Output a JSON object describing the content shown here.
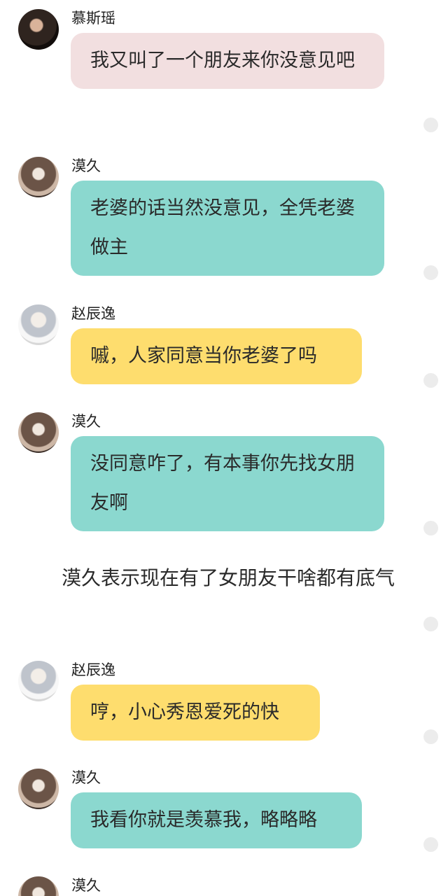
{
  "colors": {
    "pink_bubble": "#f2dfe0",
    "teal_bubble": "#8bd8cf",
    "yellow_bubble": "#fedd6e",
    "dot": "#ececec"
  },
  "messages": [
    {
      "name": "慕斯瑶",
      "text": "我又叫了一个朋友来你没意见吧",
      "color": "pink",
      "avatar": "a-dark"
    },
    {
      "name": "漠久",
      "text": "老婆的话当然没意见，全凭老婆做主",
      "color": "teal",
      "avatar": "a-hat"
    },
    {
      "name": "赵辰逸",
      "text": "嘁，人家同意当你老婆了吗",
      "color": "yellow",
      "avatar": "a-white"
    },
    {
      "name": "漠久",
      "text": "没同意咋了，有本事你先找女朋友啊",
      "color": "teal",
      "avatar": "a-hat"
    },
    {
      "name": "赵辰逸",
      "text": "哼，小心秀恩爱死的快",
      "color": "yellow",
      "avatar": "a-white"
    },
    {
      "name": "漠久",
      "text": "我看你就是羡慕我，略略略",
      "color": "teal",
      "avatar": "a-hat"
    },
    {
      "name": "漠久",
      "text": "",
      "color": "teal",
      "avatar": "a-hat"
    }
  ],
  "narration": "漠久表示现在有了女朋友干啥都有底气"
}
